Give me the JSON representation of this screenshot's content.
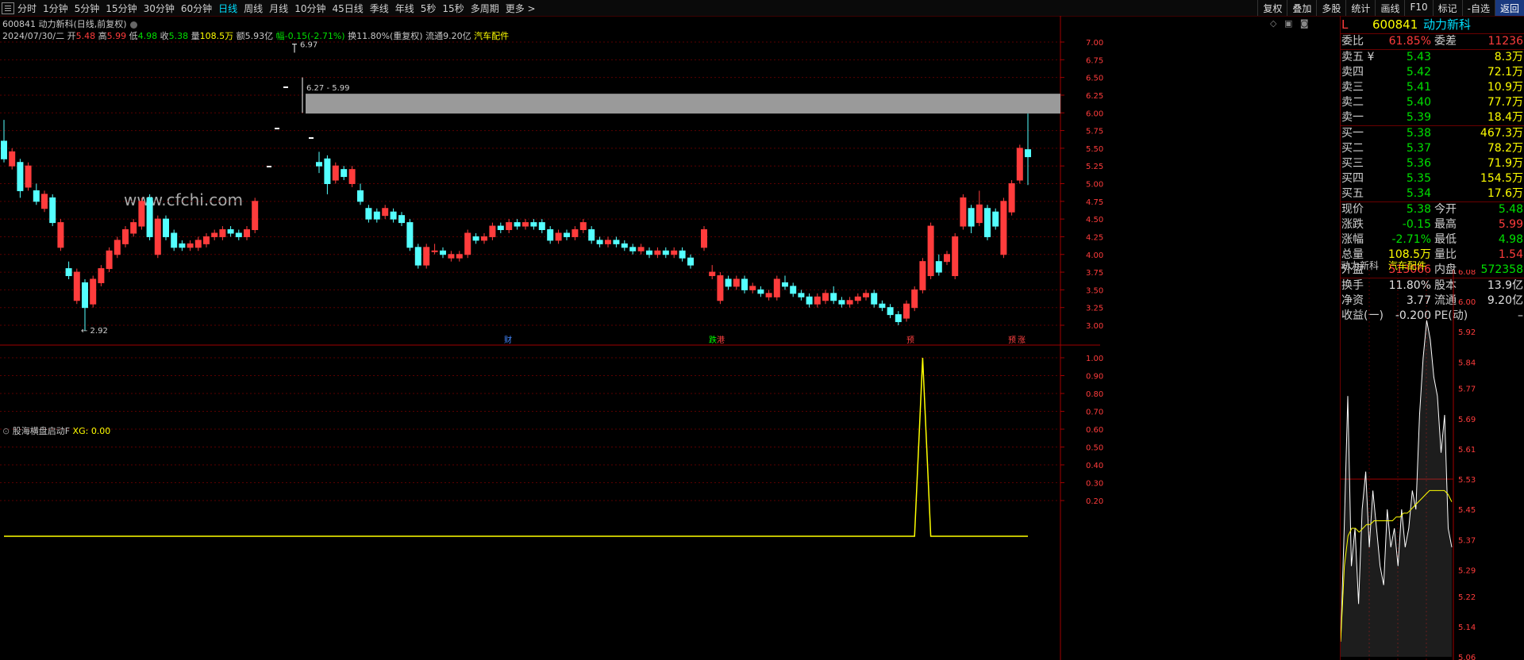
{
  "toolbar": {
    "periods": [
      "分时",
      "1分钟",
      "5分钟",
      "15分钟",
      "30分钟",
      "60分钟",
      "日线",
      "周线",
      "月线",
      "10分钟",
      "45日线",
      "季线",
      "年线",
      "5秒",
      "15秒",
      "多周期",
      "更多 >"
    ],
    "active_period": "日线",
    "right_tools": [
      "复权",
      "叠加",
      "多股",
      "统计",
      "画线",
      "F10",
      "标记",
      "-自选",
      "返回"
    ]
  },
  "header": {
    "code_title": "600841 动力新科(日线,前复权)",
    "date": "2024/07/30/二",
    "open_label": "开",
    "open": "5.48",
    "high_label": "高",
    "high": "5.99",
    "low_label": "低",
    "low": "4.98",
    "close_label": "收",
    "close": "5.38",
    "vol_label": "量",
    "vol": "108.5万",
    "amt": "额5.93亿",
    "change": "幅-0.15(-2.71%)",
    "turnover": "换11.80%(重复权) 流通9.20亿",
    "sector": "汽车配件"
  },
  "watermark": "www.cfchi.com",
  "main_chart_annotations": {
    "high_mark": "6.97",
    "low_mark": "2.92",
    "zone_label": "6.27 - 5.99",
    "event_markers": [
      "财",
      "跌",
      "港",
      "预",
      "预",
      "涨"
    ]
  },
  "indicator": {
    "title": "股海横盘启动F",
    "xg_label": "XG:",
    "xg_value": "0.00"
  },
  "chart_data": [
    {
      "type": "candlestick",
      "title": "600841 动力新科(日线,前复权)",
      "ylim": [
        2.8,
        7.2
      ],
      "y_ticks": [
        "7.00",
        "6.75",
        "6.50",
        "6.25",
        "6.00",
        "5.75",
        "5.50",
        "5.25",
        "5.00",
        "4.75",
        "4.50",
        "4.25",
        "4.00",
        "3.75",
        "3.50",
        "3.25",
        "3.00"
      ],
      "resistance_zone": [
        5.99,
        6.27
      ],
      "candles": [
        [
          5.6,
          5.35,
          5.9,
          5.3
        ],
        [
          5.25,
          5.45,
          5.5,
          5.2
        ],
        [
          5.3,
          4.9,
          5.35,
          4.8
        ],
        [
          4.95,
          5.25,
          5.3,
          4.9
        ],
        [
          4.9,
          4.75,
          5.0,
          4.7
        ],
        [
          4.65,
          4.85,
          4.9,
          4.6
        ],
        [
          4.8,
          4.45,
          4.85,
          4.4
        ],
        [
          4.1,
          4.45,
          4.5,
          4.05
        ],
        [
          3.8,
          3.7,
          3.9,
          3.65
        ],
        [
          3.35,
          3.75,
          3.8,
          3.3
        ],
        [
          3.6,
          3.25,
          3.65,
          2.92
        ],
        [
          3.3,
          3.65,
          3.7,
          3.25
        ],
        [
          3.6,
          3.8,
          3.85,
          3.55
        ],
        [
          3.8,
          4.05,
          4.1,
          3.75
        ],
        [
          4.0,
          4.2,
          4.25,
          3.95
        ],
        [
          4.15,
          4.35,
          4.4,
          4.1
        ],
        [
          4.3,
          4.45,
          4.5,
          4.25
        ],
        [
          4.4,
          4.75,
          4.8,
          4.35
        ],
        [
          4.8,
          4.25,
          4.85,
          4.2
        ],
        [
          4.0,
          4.5,
          4.55,
          3.95
        ],
        [
          4.5,
          4.25,
          4.55,
          4.2
        ],
        [
          4.3,
          4.1,
          4.35,
          4.05
        ],
        [
          4.15,
          4.1,
          4.2,
          4.05
        ],
        [
          4.1,
          4.15,
          4.2,
          4.05
        ],
        [
          4.1,
          4.2,
          4.25,
          4.05
        ],
        [
          4.15,
          4.25,
          4.3,
          4.1
        ],
        [
          4.25,
          4.3,
          4.35,
          4.2
        ],
        [
          4.25,
          4.35,
          4.4,
          4.2
        ],
        [
          4.35,
          4.3,
          4.4,
          4.25
        ],
        [
          4.3,
          4.25,
          4.35,
          4.2
        ],
        [
          4.25,
          4.35,
          4.4,
          4.2
        ],
        [
          4.35,
          4.75,
          4.8,
          4.3
        ],
        [
          5.3,
          5.25,
          5.45,
          5.15
        ],
        [
          5.35,
          5.0,
          5.4,
          4.85
        ],
        [
          5.05,
          5.25,
          5.3,
          5.0
        ],
        [
          5.2,
          5.1,
          5.25,
          5.05
        ],
        [
          5.0,
          5.2,
          5.25,
          4.95
        ],
        [
          4.9,
          4.75,
          5.0,
          4.7
        ],
        [
          4.65,
          4.5,
          4.7,
          4.45
        ],
        [
          4.6,
          4.5,
          4.65,
          4.45
        ],
        [
          4.55,
          4.65,
          4.7,
          4.5
        ],
        [
          4.6,
          4.5,
          4.65,
          4.45
        ],
        [
          4.55,
          4.45,
          4.6,
          4.4
        ],
        [
          4.45,
          4.1,
          4.5,
          4.05
        ],
        [
          4.1,
          3.85,
          4.15,
          3.8
        ],
        [
          3.85,
          4.1,
          4.15,
          3.8
        ],
        [
          4.05,
          4.05,
          4.15,
          4.0
        ],
        [
          4.05,
          4.0,
          4.1,
          3.95
        ],
        [
          3.95,
          4.0,
          4.05,
          3.9
        ],
        [
          3.95,
          4.0,
          4.05,
          3.9
        ],
        [
          4.0,
          4.3,
          4.35,
          3.95
        ],
        [
          4.25,
          4.2,
          4.3,
          4.15
        ],
        [
          4.2,
          4.25,
          4.3,
          4.15
        ],
        [
          4.25,
          4.4,
          4.45,
          4.2
        ],
        [
          4.4,
          4.35,
          4.45,
          4.3
        ],
        [
          4.35,
          4.45,
          4.5,
          4.3
        ],
        [
          4.45,
          4.4,
          4.5,
          4.35
        ],
        [
          4.4,
          4.45,
          4.5,
          4.35
        ],
        [
          4.45,
          4.4,
          4.5,
          4.35
        ],
        [
          4.45,
          4.35,
          4.5,
          4.3
        ],
        [
          4.35,
          4.2,
          4.4,
          4.15
        ],
        [
          4.2,
          4.3,
          4.35,
          4.15
        ],
        [
          4.3,
          4.25,
          4.35,
          4.2
        ],
        [
          4.25,
          4.35,
          4.4,
          4.2
        ],
        [
          4.35,
          4.45,
          4.5,
          4.3
        ],
        [
          4.35,
          4.2,
          4.4,
          4.15
        ],
        [
          4.2,
          4.15,
          4.25,
          4.1
        ],
        [
          4.15,
          4.2,
          4.25,
          4.1
        ],
        [
          4.2,
          4.15,
          4.25,
          4.1
        ],
        [
          4.15,
          4.1,
          4.2,
          4.05
        ],
        [
          4.1,
          4.05,
          4.15,
          4.0
        ],
        [
          4.05,
          4.1,
          4.15,
          4.0
        ],
        [
          4.05,
          4.0,
          4.1,
          3.95
        ],
        [
          4.0,
          4.05,
          4.1,
          3.95
        ],
        [
          4.05,
          4.0,
          4.1,
          3.95
        ],
        [
          4.0,
          4.05,
          4.1,
          3.95
        ],
        [
          4.05,
          3.95,
          4.1,
          3.9
        ],
        [
          3.95,
          3.85,
          4.0,
          3.8
        ],
        [
          4.1,
          4.35,
          4.4,
          4.05
        ],
        [
          3.7,
          3.75,
          3.85,
          3.65
        ],
        [
          3.35,
          3.7,
          3.75,
          3.3
        ],
        [
          3.65,
          3.55,
          3.7,
          3.5
        ],
        [
          3.55,
          3.65,
          3.7,
          3.5
        ],
        [
          3.65,
          3.5,
          3.7,
          3.45
        ],
        [
          3.5,
          3.55,
          3.6,
          3.45
        ],
        [
          3.5,
          3.45,
          3.55,
          3.4
        ],
        [
          3.4,
          3.45,
          3.5,
          3.35
        ],
        [
          3.4,
          3.65,
          3.7,
          3.35
        ],
        [
          3.6,
          3.55,
          3.7,
          3.5
        ],
        [
          3.55,
          3.45,
          3.6,
          3.4
        ],
        [
          3.45,
          3.4,
          3.5,
          3.35
        ],
        [
          3.4,
          3.3,
          3.45,
          3.25
        ],
        [
          3.3,
          3.4,
          3.45,
          3.25
        ],
        [
          3.35,
          3.45,
          3.5,
          3.3
        ],
        [
          3.45,
          3.35,
          3.55,
          3.3
        ],
        [
          3.35,
          3.3,
          3.4,
          3.25
        ],
        [
          3.3,
          3.35,
          3.4,
          3.25
        ],
        [
          3.35,
          3.4,
          3.45,
          3.3
        ],
        [
          3.4,
          3.45,
          3.5,
          3.35
        ],
        [
          3.45,
          3.3,
          3.5,
          3.25
        ],
        [
          3.3,
          3.25,
          3.35,
          3.2
        ],
        [
          3.25,
          3.15,
          3.3,
          3.1
        ],
        [
          3.15,
          3.05,
          3.2,
          3.0
        ],
        [
          3.1,
          3.3,
          3.35,
          3.05
        ],
        [
          3.25,
          3.5,
          3.55,
          3.2
        ],
        [
          3.5,
          3.9,
          3.95,
          3.45
        ],
        [
          3.7,
          4.4,
          4.45,
          3.65
        ],
        [
          3.9,
          3.75,
          4.0,
          3.7
        ],
        [
          3.9,
          4.0,
          4.05,
          3.85
        ],
        [
          3.7,
          4.25,
          4.3,
          3.65
        ],
        [
          4.4,
          4.8,
          4.85,
          4.35
        ],
        [
          4.65,
          4.4,
          4.7,
          4.3
        ],
        [
          4.45,
          4.7,
          4.9,
          4.4
        ],
        [
          4.65,
          4.25,
          4.7,
          4.2
        ],
        [
          4.6,
          4.4,
          4.65,
          4.35
        ],
        [
          4.0,
          4.75,
          4.8,
          3.95
        ],
        [
          4.6,
          5.0,
          5.05,
          4.55
        ],
        [
          5.05,
          5.5,
          5.55,
          5.0
        ],
        [
          5.48,
          5.38,
          5.99,
          4.98
        ]
      ]
    },
    {
      "type": "line",
      "title": "股海横盘启动F",
      "ylim": [
        0,
        1.05
      ],
      "y_ticks": [
        "1.00",
        "0.90",
        "0.80",
        "0.70",
        "0.60",
        "0.50",
        "0.40",
        "0.30",
        "0.20"
      ],
      "series": [
        {
          "name": "XG",
          "spike_index": 105,
          "spike_value": 1.0,
          "count": 121
        }
      ]
    },
    {
      "type": "line",
      "title": "分时",
      "ylim": [
        5.06,
        6.08
      ],
      "y_ticks": [
        "6.08",
        "6.00",
        "5.92",
        "5.84",
        "5.77",
        "5.69",
        "5.61",
        "5.53",
        "5.45",
        "5.37",
        "5.29",
        "5.22",
        "5.14",
        "5.06"
      ],
      "series": [
        {
          "name": "price"
        },
        {
          "name": "avg"
        }
      ]
    }
  ],
  "quote": {
    "head_code": "600841",
    "head_name": "动力新科",
    "head_flag": "L",
    "weibi_label": "委比",
    "weibi": "61.85%",
    "weicha_label": "委差",
    "weicha": "11236",
    "sells": [
      {
        "label": "卖五 ¥",
        "price": "5.43",
        "vol": "8.3万"
      },
      {
        "label": "卖四",
        "price": "5.42",
        "vol": "72.1万"
      },
      {
        "label": "卖三",
        "price": "5.41",
        "vol": "10.9万"
      },
      {
        "label": "卖二",
        "price": "5.40",
        "vol": "77.7万"
      },
      {
        "label": "卖一",
        "price": "5.39",
        "vol": "18.4万"
      }
    ],
    "buys": [
      {
        "label": "买一",
        "price": "5.38",
        "vol": "467.3万"
      },
      {
        "label": "买二",
        "price": "5.37",
        "vol": "78.2万"
      },
      {
        "label": "买三",
        "price": "5.36",
        "vol": "71.9万"
      },
      {
        "label": "买四",
        "price": "5.35",
        "vol": "154.5万"
      },
      {
        "label": "买五",
        "price": "5.34",
        "vol": "17.6万"
      }
    ],
    "stats": [
      {
        "l1": "现价",
        "v1": "5.38",
        "l2": "今开",
        "v2": "5.48",
        "c1": "#00e000",
        "c2": "#00e000"
      },
      {
        "l1": "涨跌",
        "v1": "-0.15",
        "l2": "最高",
        "v2": "5.99",
        "c1": "#00e000",
        "c2": "#ff3c3c"
      },
      {
        "l1": "涨幅",
        "v1": "-2.71%",
        "l2": "最低",
        "v2": "4.98",
        "c1": "#00e000",
        "c2": "#00e000"
      },
      {
        "l1": "总量",
        "v1": "108.5万",
        "l2": "量比",
        "v2": "1.54",
        "c1": "#ffff00",
        "c2": "#ff3c3c"
      },
      {
        "l1": "外盘",
        "v1": "513066",
        "l2": "内盘",
        "v2": "572358",
        "c1": "#ff3c3c",
        "c2": "#00e000"
      }
    ],
    "stats2": [
      {
        "l1": "换手",
        "v1": "11.80%",
        "l2": "股本",
        "v2": "13.9亿"
      },
      {
        "l1": "净资",
        "v1": "3.77",
        "l2": "流通",
        "v2": "9.20亿"
      },
      {
        "l1": "收益(一)",
        "v1": "-0.200",
        "l2": "PE(动)",
        "v2": "–"
      }
    ],
    "mini_name": "动力新科",
    "mini_sector": "汽车配件"
  }
}
